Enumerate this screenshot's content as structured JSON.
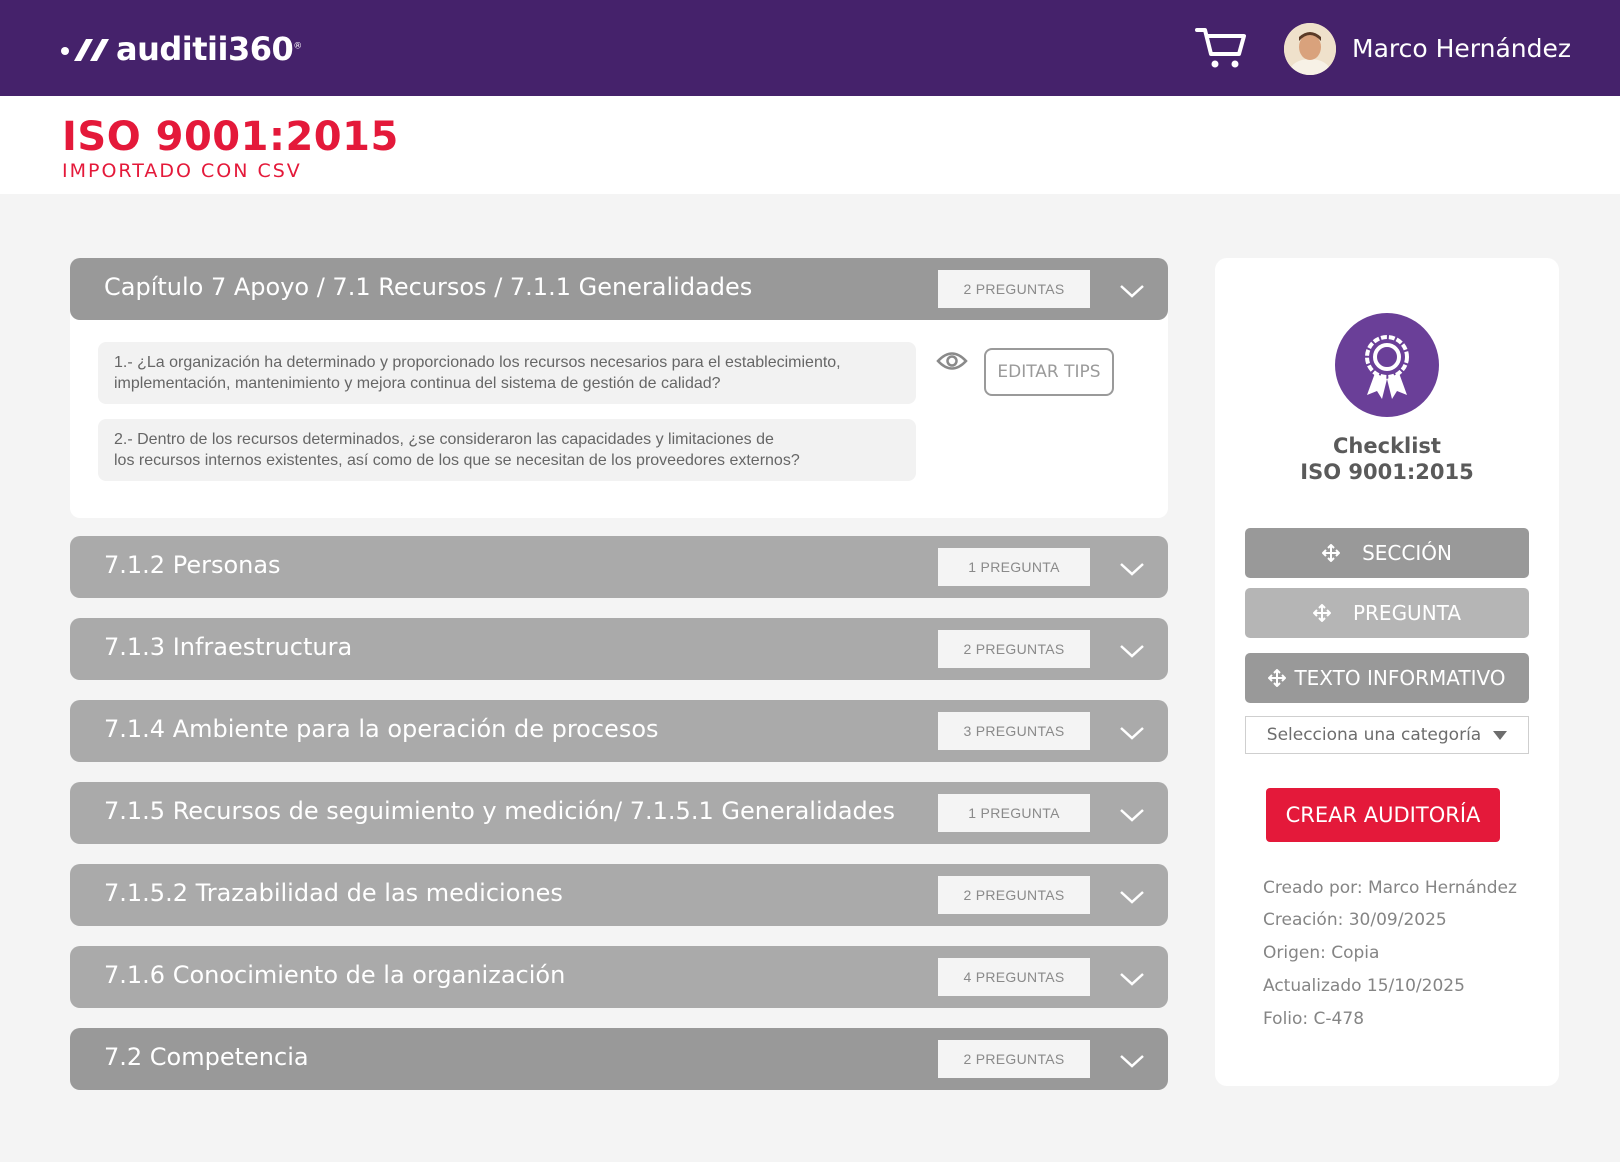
{
  "header": {
    "brand": "auditii360",
    "brand_mark": "®",
    "user_name": "Marco Hernández",
    "icons": [
      "cart-icon",
      "avatar"
    ]
  },
  "document": {
    "title": "ISO 9001:2015",
    "subtitle": "IMPORTADO CON CSV"
  },
  "sections": [
    {
      "title": "Capítulo 7 Apoyo / 7.1 Recursos / 7.1.1 Generalidades",
      "count": "2 PREGUNTAS",
      "expanded": true
    },
    {
      "title": "7.1.2  Personas",
      "count": "1 PREGUNTA",
      "expanded": false
    },
    {
      "title": "7.1.3 Infraestructura",
      "count": "2 PREGUNTAS",
      "expanded": false
    },
    {
      "title": "7.1.4 Ambiente para la operación de procesos",
      "count": "3 PREGUNTAS",
      "expanded": false
    },
    {
      "title": "7.1.5 Recursos de seguimiento y medición/ 7.1.5.1 Generalidades",
      "count": "1 PREGUNTA",
      "expanded": false
    },
    {
      "title": "7.1.5.2 Trazabilidad de las mediciones",
      "count": "2 PREGUNTAS",
      "expanded": false
    },
    {
      "title": "7.1.6 Conocimiento de la organización",
      "count": "4 PREGUNTAS",
      "expanded": false
    },
    {
      "title": "7.2 Competencia",
      "count": "2 PREGUNTAS",
      "expanded": false
    }
  ],
  "questions": [
    {
      "line1": "1.- ¿La organización ha determinado y proporcionado los recursos necesarios para el establecimiento,",
      "line2": "implementación, mantenimiento y mejora continua del sistema de gestión de calidad?"
    },
    {
      "line1": "2.- Dentro de los recursos determinados, ¿se consideraron las capacidades y limitaciones de",
      "line2": "los recursos internos existentes, así como de los que se necesitan de los proveedores externos?"
    }
  ],
  "edit_tips_label": "EDITAR TIPS",
  "card": {
    "title_line1": "Checklist",
    "title_line2": "ISO 9001:2015",
    "btn_section": "SECCIÓN",
    "btn_question": "PREGUNTA",
    "btn_info": "TEXTO INFORMATIVO",
    "select_placeholder": "Selecciona una categoría",
    "create_label": "CREAR AUDITORÍA",
    "meta": {
      "created_by": "Creado por: Marco Hernández",
      "created": "Creación: 30/09/2025",
      "origin": "Origen: Copia",
      "updated": "Actualizado 15/10/2025",
      "folio": "Folio: C-478"
    }
  },
  "colors": {
    "header_bg": "#45226b",
    "accent_red": "#e4193a",
    "badge_purple": "#6a3f98"
  }
}
